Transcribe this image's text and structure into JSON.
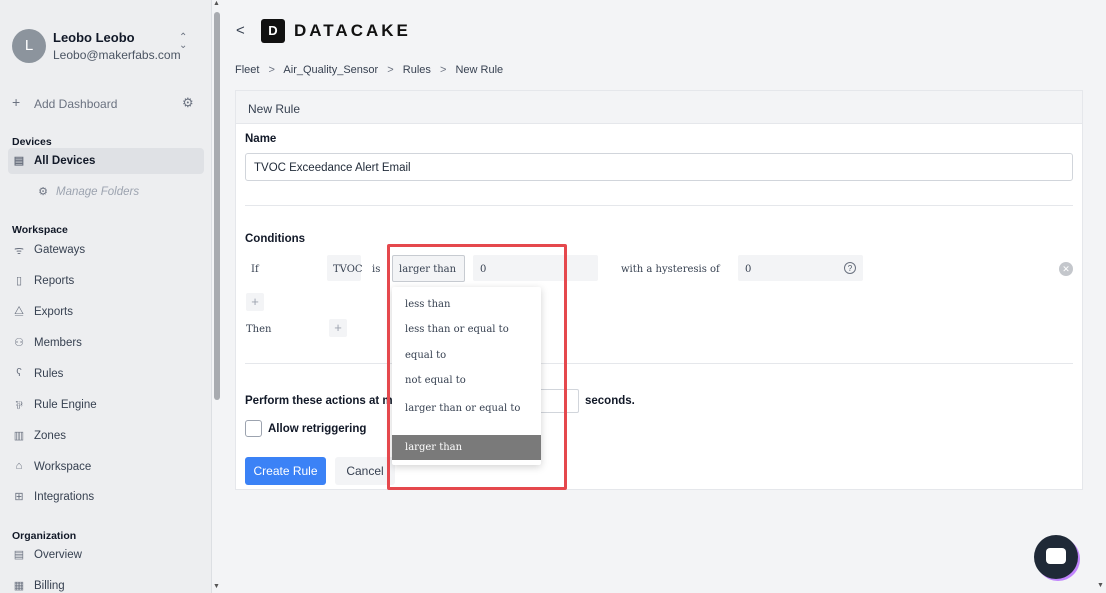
{
  "user": {
    "initial": "L",
    "name": "Leobo Leobo",
    "email": "Leobo@makerfabs.com"
  },
  "sidebar": {
    "add_dashboard": "Add Dashboard",
    "sections": {
      "devices": "Devices",
      "workspace": "Workspace",
      "organization": "Organization"
    },
    "items": {
      "all_devices": "All Devices",
      "manage_folders": "Manage Folders",
      "gateways": "Gateways",
      "reports": "Reports",
      "exports": "Exports",
      "members": "Members",
      "rules": "Rules",
      "rule_engine": "Rule Engine",
      "zones": "Zones",
      "workspace": "Workspace",
      "integrations": "Integrations",
      "overview": "Overview",
      "billing": "Billing"
    }
  },
  "header": {
    "back_symbol": "<",
    "logo_mark": "D",
    "logo_text": "DATACAKE"
  },
  "breadcrumb": [
    "Fleet",
    "Air_Quality_Sensor",
    "Rules",
    "New Rule"
  ],
  "breadcrumb_sep": ">",
  "card": {
    "title": "New Rule",
    "name_label": "Name",
    "name_value": "TVOC Exceedance Alert Email",
    "conditions_label": "Conditions",
    "if_label": "If",
    "field": "TVOC",
    "is_label": "is",
    "operator": "larger than",
    "value": "0",
    "hysteresis_label": "with a hysteresis of",
    "hysteresis_value": "0",
    "then_label": "Then",
    "perform_label": "Perform these actions at mo",
    "seconds_label": "seconds.",
    "allow_retrigger": "Allow retriggering",
    "create_button": "Create Rule",
    "cancel_button": "Cancel"
  },
  "dropdown": {
    "options": [
      "less than",
      "less than or equal to",
      "equal to",
      "not equal to",
      "larger than or equal to",
      "larger than"
    ],
    "selected": "larger than"
  },
  "colors": {
    "accent": "#3b82f6",
    "highlight": "#e5484d"
  }
}
